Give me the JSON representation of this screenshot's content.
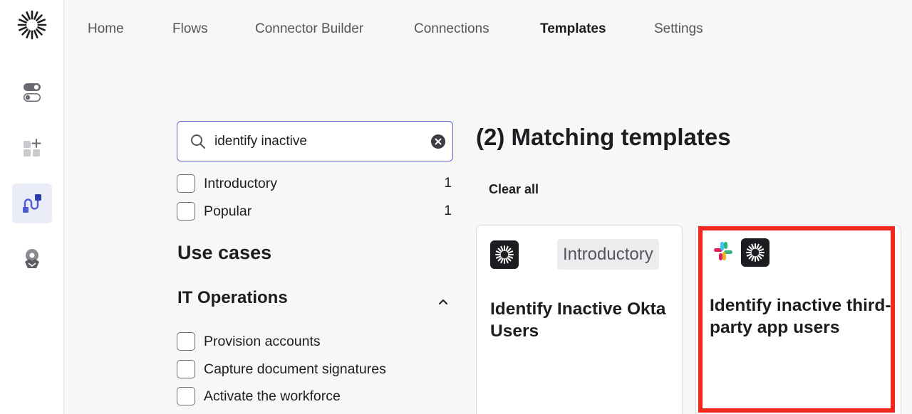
{
  "nav": {
    "items": [
      {
        "label": "Home",
        "active": false
      },
      {
        "label": "Flows",
        "active": false
      },
      {
        "label": "Connector Builder",
        "active": false
      },
      {
        "label": "Connections",
        "active": false
      },
      {
        "label": "Templates",
        "active": true
      },
      {
        "label": "Settings",
        "active": false
      }
    ]
  },
  "sidebar": {
    "icons": [
      "toggle-icon",
      "add-widgets-icon",
      "flow-icon",
      "connections-icon"
    ],
    "active": "flow-icon"
  },
  "search": {
    "value": "identify inactive"
  },
  "filters": [
    {
      "label": "Introductory",
      "count": "1",
      "checked": false
    },
    {
      "label": "Popular",
      "count": "1",
      "checked": false
    }
  ],
  "use_cases": {
    "heading": "Use cases",
    "group": "IT Operations",
    "items": [
      {
        "label": "Provision accounts",
        "checked": false
      },
      {
        "label": "Capture document signatures",
        "checked": false
      },
      {
        "label": "Activate the workforce",
        "checked": false
      }
    ]
  },
  "results": {
    "title": "(2) Matching templates",
    "clear_all": "Clear all",
    "cards": [
      {
        "title": "Identify Inactive Okta Users",
        "tag": "Introductory",
        "apps": [
          "okta-logo-icon"
        ]
      },
      {
        "title": "Identify inactive third-party app users",
        "tag": "",
        "apps": [
          "slack-logo-icon",
          "okta-logo-icon"
        ]
      }
    ]
  },
  "colors": {
    "accent": "#5b63d3",
    "highlight": "#f2281f",
    "active_rail_bg": "#eaecf7"
  }
}
